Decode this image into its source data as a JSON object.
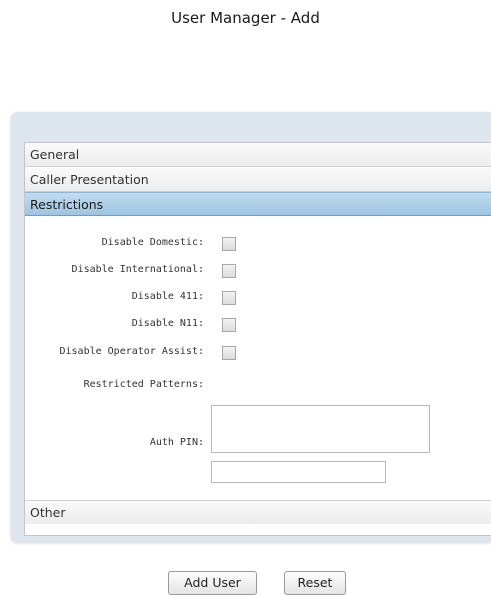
{
  "page": {
    "title": "User Manager - Add"
  },
  "accordion": {
    "sections": [
      {
        "label": "General",
        "active": false
      },
      {
        "label": "Caller Presentation",
        "active": false
      },
      {
        "label": "Restrictions",
        "active": true
      },
      {
        "label": "Other",
        "active": false
      }
    ]
  },
  "restrictions": {
    "disable_domestic": {
      "label": "Disable Domestic:",
      "checked": false
    },
    "disable_international": {
      "label": "Disable International:",
      "checked": false
    },
    "disable_411": {
      "label": "Disable 411:",
      "checked": false
    },
    "disable_n11": {
      "label": "Disable N11:",
      "checked": false
    },
    "disable_operator_assist": {
      "label": "Disable Operator Assist:",
      "checked": false
    },
    "restricted_patterns": {
      "label": "Restricted Patterns:",
      "value": ""
    },
    "auth_pin": {
      "label": "Auth PIN:",
      "value": ""
    }
  },
  "actions": {
    "add_user_label": "Add User",
    "reset_label": "Reset"
  },
  "colors": {
    "panel_background": "#dde5ee",
    "active_header": "#9cc4e2",
    "content_background": "#ffffff"
  }
}
